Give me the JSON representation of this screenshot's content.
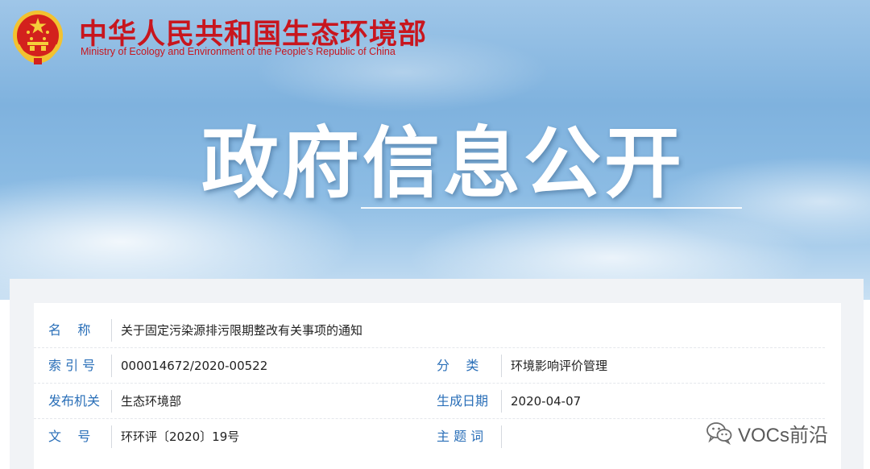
{
  "header": {
    "org_name_cn": "中华人民共和国生态环境部",
    "org_name_en": "Ministry of Ecology and Environment of the People's Republic of China",
    "section_title": "政府信息公开"
  },
  "colors": {
    "brand_red": "#c8161e",
    "label_blue": "#2a6fb8"
  },
  "document": {
    "rows": [
      {
        "label": "名    称",
        "value": "关于固定污染源排污限期整改有关事项的通知"
      },
      {
        "label": "索 引 号",
        "value": "000014672/2020-00522",
        "label2": "分    类",
        "value2": "环境影响评价管理"
      },
      {
        "label": "发布机关",
        "value": "生态环境部",
        "label2": "生成日期",
        "value2": "2020-04-07"
      },
      {
        "label": "文    号",
        "value": "环环评〔2020〕19号",
        "label2": "主 题 词",
        "value2": ""
      }
    ]
  },
  "watermark": {
    "icon": "wechat-icon",
    "text": "VOCs前沿"
  }
}
